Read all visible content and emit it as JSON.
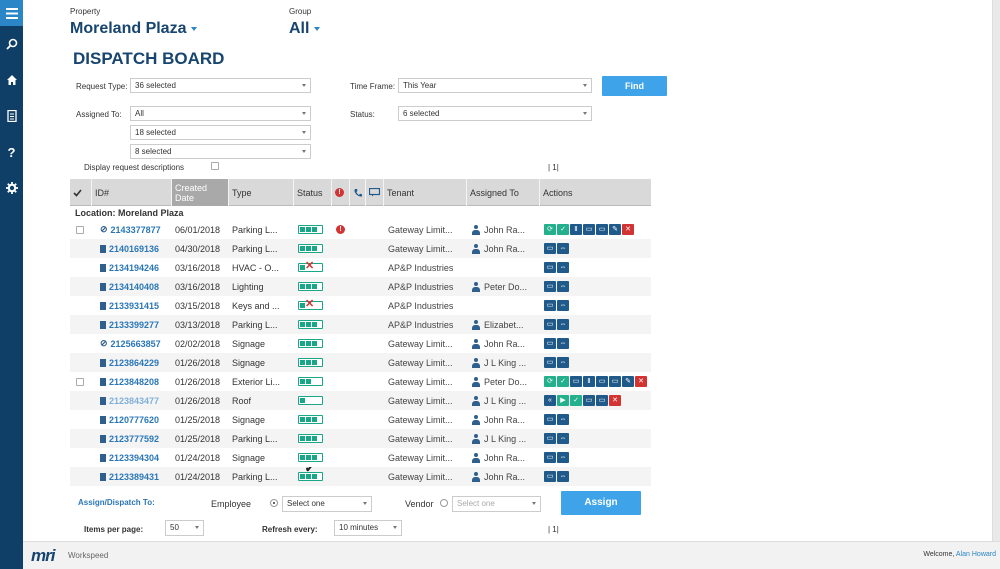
{
  "sidebar": {
    "items": [
      {
        "name": "menu-icon"
      },
      {
        "name": "search-icon"
      },
      {
        "name": "home-icon"
      },
      {
        "name": "document-icon"
      },
      {
        "name": "help-icon"
      },
      {
        "name": "gear-icon"
      }
    ]
  },
  "header": {
    "property_label": "Property",
    "property_value": "Moreland Plaza",
    "group_label": "Group",
    "group_value": "All",
    "title": "DISPATCH BOARD"
  },
  "filters": {
    "request_type_label": "Request Type:",
    "request_type_value": "36 selected",
    "time_frame_label": "Time Frame:",
    "time_frame_value": "This Year",
    "find_label": "Find",
    "assigned_to_label": "Assigned To:",
    "assigned_to_value": "All",
    "assigned_sub1": "18 selected",
    "assigned_sub2": "8 selected",
    "status_label": "Status:",
    "status_value": "6 selected",
    "display_desc_label": "Display request descriptions",
    "pager_top": "| 1|"
  },
  "grid": {
    "columns": {
      "id": "ID#",
      "created_line1": "Created",
      "created_line2": "Date",
      "type": "Type",
      "status": "Status",
      "tenant": "Tenant",
      "assigned": "Assigned To",
      "actions": "Actions"
    },
    "location": "Location: Moreland Plaza",
    "rows": [
      {
        "id": "2143377877",
        "date": "06/01/2018",
        "type": "Parking L...",
        "tenant": "Gateway Limit...",
        "assigned": "John Ra...",
        "status": "3bar"
      },
      {
        "id": "2140169136",
        "date": "04/30/2018",
        "type": "Parking L...",
        "tenant": "Gateway Limit...",
        "assigned": "John Ra...",
        "status": "3bar"
      },
      {
        "id": "2134194246",
        "date": "03/16/2018",
        "type": "HVAC - O...",
        "tenant": "AP&P Industries",
        "assigned": "",
        "status": "x"
      },
      {
        "id": "2134140408",
        "date": "03/16/2018",
        "type": "Lighting",
        "tenant": "AP&P Industries",
        "assigned": "Peter Do...",
        "status": "3bar"
      },
      {
        "id": "2133931415",
        "date": "03/15/2018",
        "type": "Keys and ...",
        "tenant": "AP&P Industries",
        "assigned": "",
        "status": "x"
      },
      {
        "id": "2133399277",
        "date": "03/13/2018",
        "type": "Parking L...",
        "tenant": "AP&P Industries",
        "assigned": "Elizabet...",
        "status": "3bar"
      },
      {
        "id": "2125663857",
        "date": "02/02/2018",
        "type": "Signage",
        "tenant": "Gateway Limit...",
        "assigned": "John Ra...",
        "status": "3bar"
      },
      {
        "id": "2123864229",
        "date": "01/26/2018",
        "type": "Signage",
        "tenant": "Gateway Limit...",
        "assigned": "J L King ...",
        "status": "3bar"
      },
      {
        "id": "2123848208",
        "date": "01/26/2018",
        "type": "Exterior Li...",
        "tenant": "Gateway Limit...",
        "assigned": "Peter Do...",
        "status": "2bar"
      },
      {
        "id": "2123843477",
        "date": "01/26/2018",
        "type": "Roof",
        "tenant": "Gateway Limit...",
        "assigned": "J L King ...",
        "status": "1bar"
      },
      {
        "id": "2120777620",
        "date": "01/25/2018",
        "type": "Signage",
        "tenant": "Gateway Limit...",
        "assigned": "John Ra...",
        "status": "3bar"
      },
      {
        "id": "2123777592",
        "date": "01/25/2018",
        "type": "Parking L...",
        "tenant": "Gateway Limit...",
        "assigned": "J L King ...",
        "status": "3bar"
      },
      {
        "id": "2123394304",
        "date": "01/24/2018",
        "type": "Signage",
        "tenant": "Gateway Limit...",
        "assigned": "John Ra...",
        "status": "3bar"
      },
      {
        "id": "2123389431",
        "date": "01/24/2018",
        "type": "Parking L...",
        "tenant": "Gateway Limit...",
        "assigned": "John Ra...",
        "status": "check"
      }
    ]
  },
  "footer": {
    "assign_label": "Assign/Dispatch To:",
    "employee_label": "Employee",
    "employee_value": "Select one",
    "vendor_label": "Vendor",
    "vendor_value": "Select one",
    "assign_button": "Assign",
    "items_per_page_label": "Items per page:",
    "items_per_page_value": "50",
    "refresh_label": "Refresh every:",
    "refresh_value": "10 minutes",
    "pager_bottom": "| 1|"
  },
  "bottom_bar": {
    "logo": "mri",
    "product": "Workspeed",
    "welcome": "Welcome,",
    "user": "Alan Howard"
  },
  "colors": {
    "navy": "#0f3e66",
    "accent": "#2a86c6",
    "title": "#17456f",
    "status_green": "#1aa787",
    "alert_red": "#d23434"
  }
}
